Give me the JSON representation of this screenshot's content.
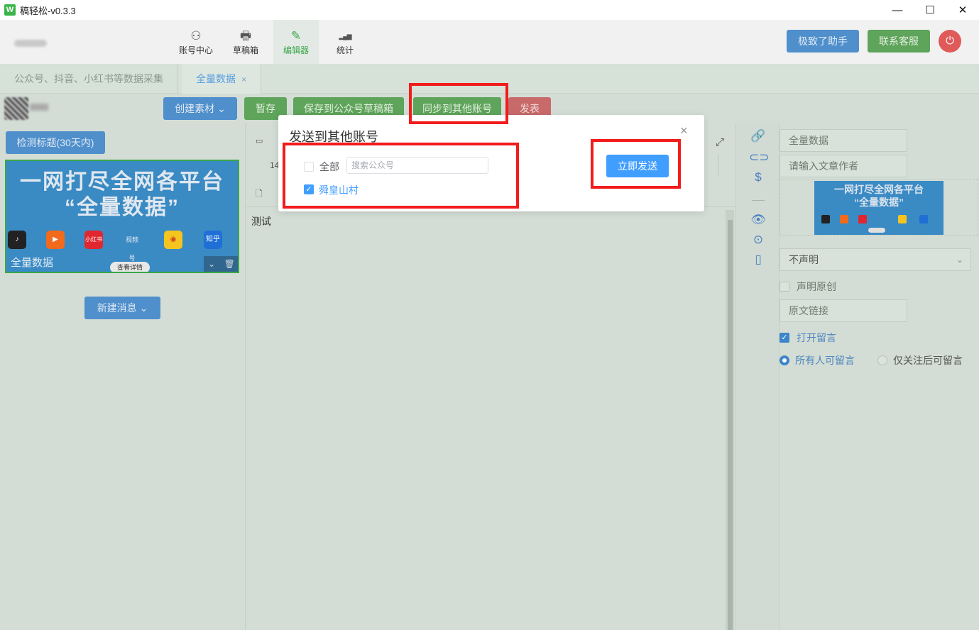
{
  "window": {
    "title": "稿轻松-v0.3.3",
    "icon_text": "W",
    "controls": {
      "minimize": "—",
      "maximize": "☐",
      "close": "✕"
    }
  },
  "topnav": {
    "items": [
      {
        "label": "账号中心",
        "icon": "user-icon",
        "glyph": "⚇"
      },
      {
        "label": "草稿箱",
        "icon": "printer-icon",
        "glyph": "🖶"
      },
      {
        "label": "编辑器",
        "icon": "pencil-icon",
        "glyph": "✎"
      },
      {
        "label": "统计",
        "icon": "bar-chart-icon",
        "glyph": "▂▄▆"
      }
    ],
    "helper_label": "极致了助手",
    "service_label": "联系客服",
    "power_glyph": "⏻"
  },
  "tabs": [
    {
      "label": "公众号、抖音、小红书等数据采集",
      "active": false
    },
    {
      "label": "全量数据",
      "active": true,
      "close": "×"
    }
  ],
  "toolbar": {
    "create_label": "创建素材",
    "stash_label": "暂存",
    "save_draft_label": "保存到公众号草稿箱",
    "sync_label": "同步到其他账号",
    "publish_label": "发表"
  },
  "left": {
    "check_title_label": "检测标题(30天内)",
    "banner": {
      "line1": "一网打尽全网各平台",
      "line2": "“全量数据”",
      "caption": "全量数据",
      "view_label": "查看详情",
      "icons": [
        {
          "name": "douyin-icon",
          "text": "♪",
          "color": "#222222"
        },
        {
          "name": "kuaishou-icon",
          "text": "▶",
          "color": "#f26a1b"
        },
        {
          "name": "xiaohongshu-icon",
          "text": "小红书",
          "color": "#e0272f"
        },
        {
          "name": "shipinhao-icon",
          "text": "视频号",
          "color": "#3a8ac4"
        },
        {
          "name": "weibo-icon",
          "text": "◉",
          "color": "#f5c41f"
        },
        {
          "name": "zhihu-icon",
          "text": "知乎",
          "color": "#1f6fd6"
        }
      ]
    },
    "new_message_label": "新建消息"
  },
  "editor": {
    "font_size_partial": "14",
    "body_text": "测试"
  },
  "right": {
    "title_value": "全量数据",
    "author_placeholder": "请输入文章作者",
    "thumb_line1": "一网打尽全网各平台",
    "thumb_line2": "“全量数据”",
    "declare_select": "不声明",
    "original_label": "声明原创",
    "source_link_placeholder": "原文链接",
    "open_comments_label": "打开留言",
    "comment_all_label": "所有人可留言",
    "comment_followers_label": "仅关注后可留言"
  },
  "modal": {
    "title": "发送到其他账号",
    "select_all_label": "全部",
    "search_placeholder": "搜索公众号",
    "account_label": "舜皇山村",
    "account_checked": true,
    "send_label": "立即发送",
    "close": "×"
  },
  "colors": {
    "primary_blue": "#409eff",
    "highlight_red": "#f21c1c",
    "brand_green": "#3aa64a"
  }
}
